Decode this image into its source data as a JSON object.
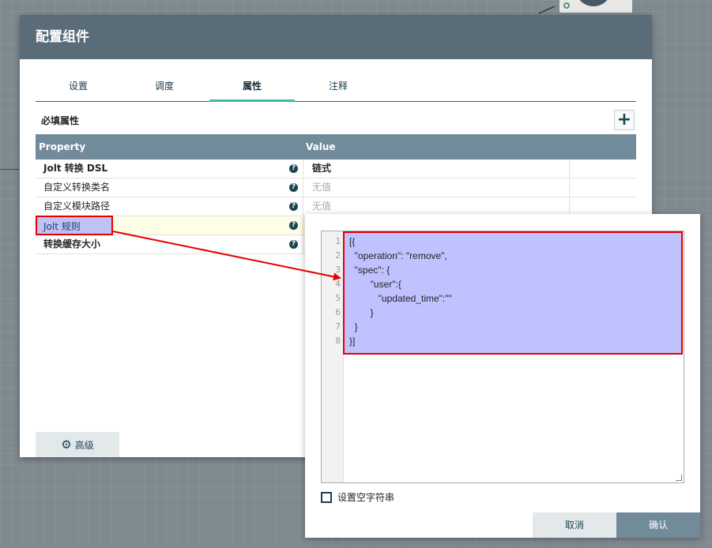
{
  "dialog": {
    "title": "配置组件",
    "tabs": [
      {
        "label": "设置"
      },
      {
        "label": "调度"
      },
      {
        "label": "属性"
      },
      {
        "label": "注释"
      }
    ],
    "required_label": "必填属性",
    "table": {
      "col_property": "Property",
      "col_value": "Value",
      "rows": [
        {
          "name": "Jolt 转换 DSL",
          "value": "链式"
        },
        {
          "name": "自定义转换类名",
          "value": "无值"
        },
        {
          "name": "自定义模块路径",
          "value": "无值"
        },
        {
          "name": "Jolt 规则",
          "value": ""
        },
        {
          "name": "转换缓存大小",
          "value": ""
        }
      ]
    },
    "advanced_label": "高级"
  },
  "editor": {
    "line_numbers": [
      "1",
      "2",
      "3",
      "4",
      "5",
      "6",
      "7",
      "8"
    ],
    "lines": [
      "[{",
      "  \"operation\": \"remove\",",
      "  \"spec\": {",
      "        \"user\":{",
      "           \"updated_time\":\"\"",
      "        }",
      "  }",
      "}]"
    ],
    "empty_string_label": "设置空字符串",
    "cancel_label": "取消",
    "ok_label": "确认"
  },
  "colors": {
    "header": "#5a6c78",
    "table_header": "#728b9b",
    "tab_active": "#40b8a6",
    "annotation": "#e60000",
    "selection": "#c0c2ff"
  }
}
